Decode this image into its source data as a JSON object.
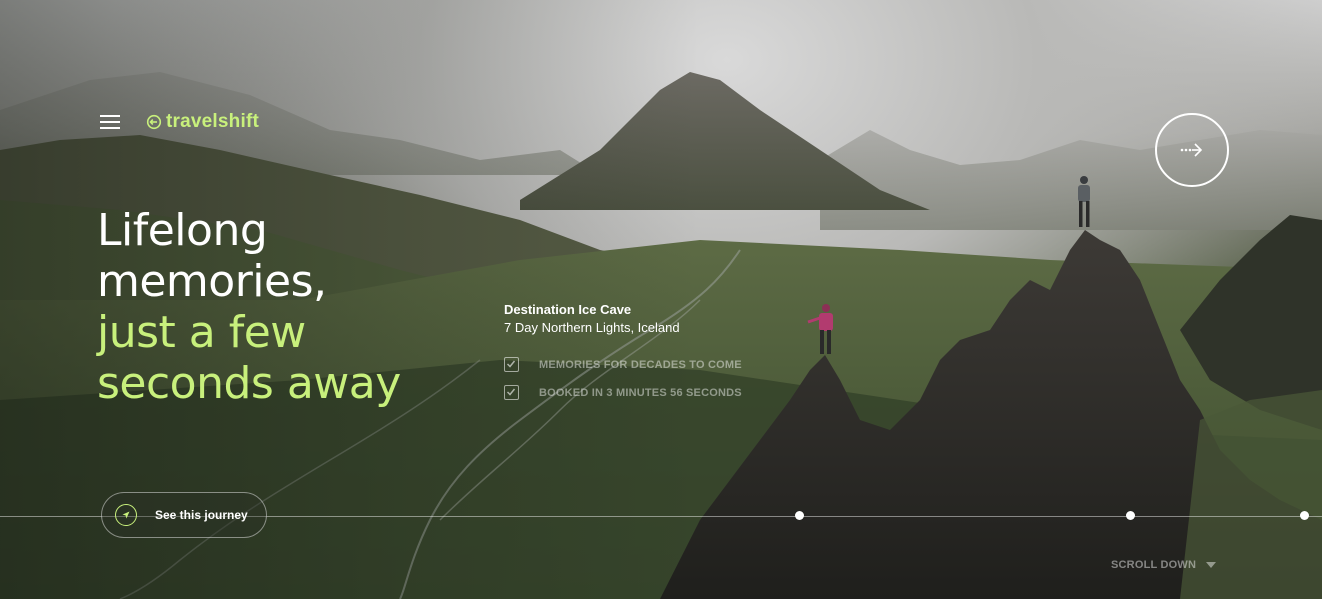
{
  "header": {
    "logo_text": "travelshift",
    "menu_icon": "hamburger-menu-icon",
    "logo_icon": "arrow-circle-icon"
  },
  "hero": {
    "headline_line1": "Lifelong",
    "headline_line2": "memories,",
    "headline_line3": "just a few",
    "headline_line4": "seconds away"
  },
  "destination": {
    "title": "Destination Ice Cave",
    "subtitle": "7 Day Northern Lights, Iceland",
    "features": [
      {
        "label": "MEMORIES FOR DECADES TO COME"
      },
      {
        "label": "BOOKED IN 3 MINUTES 56 SECONDS"
      }
    ]
  },
  "navigation": {
    "next_icon": "dotted-arrow-right-icon",
    "journey_button_label": "See this journey",
    "journey_icon": "compass-navigation-icon",
    "scroll_down_label": "SCROLL DOWN",
    "scroll_icon": "caret-down-icon"
  },
  "colors": {
    "accent": "#c8f07c",
    "text": "#ffffff"
  }
}
